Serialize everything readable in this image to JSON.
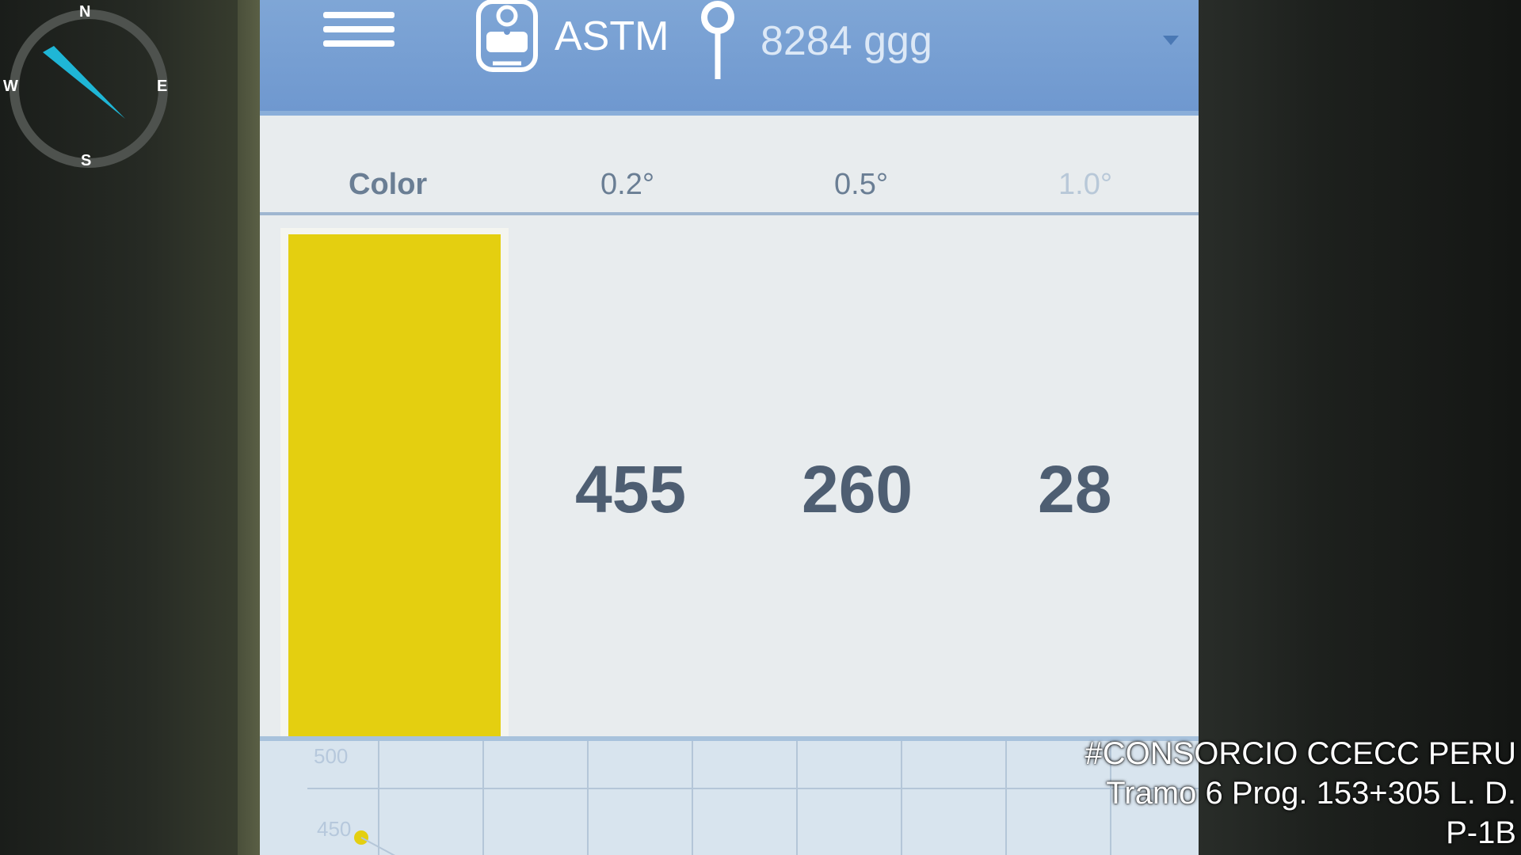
{
  "compass": {
    "north": "N",
    "east": "E",
    "south": "S",
    "west": "W"
  },
  "device": {
    "menu_icon": "hamburger-menu-icon",
    "device_icon": "glossmeter-device-icon",
    "standard": "ASTM",
    "location_icon": "pin-icon",
    "gloss_reading": "8284 ggg",
    "dropdown_icon": "caret-down-icon"
  },
  "table": {
    "headers": [
      "Color",
      "0.2°",
      "0.5°",
      "1.0°"
    ],
    "swatch_color": "#e4cf10",
    "values": [
      "455",
      "260",
      "28"
    ]
  },
  "chart": {
    "y_ticks": [
      "500",
      "450"
    ]
  },
  "watermark": {
    "line1": "#CONSORCIO CCECC PERU",
    "line2": "Tramo 6 Prog. 153+305 L. D.",
    "line3": "P-1B"
  }
}
